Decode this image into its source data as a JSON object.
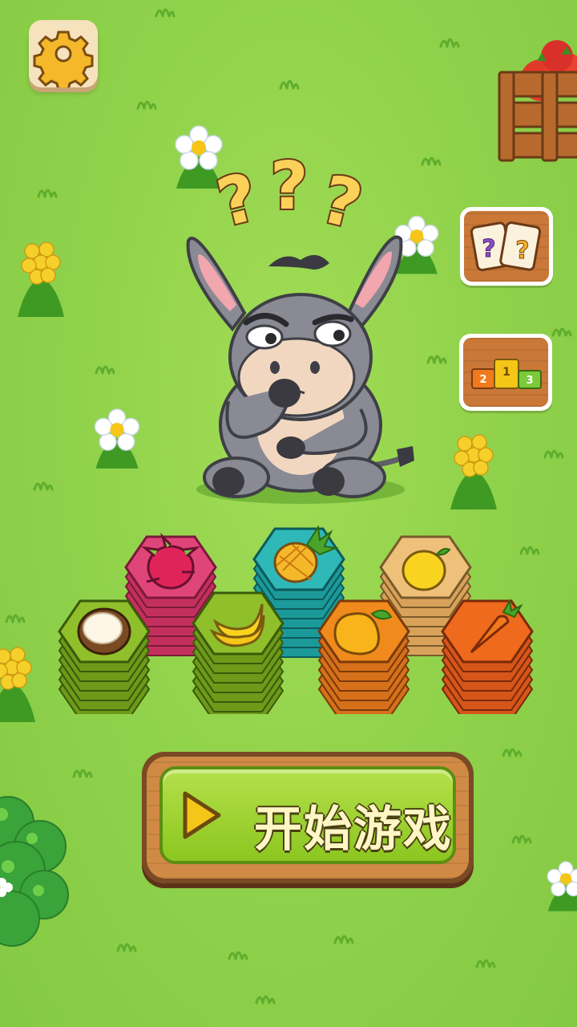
{
  "game": {
    "start_button_label": "开始游戏",
    "leaderboard_ranks": [
      "2",
      "1",
      "3"
    ],
    "help_card_symbols": [
      "?",
      "?"
    ],
    "mascot_thought": [
      "?",
      "?",
      "?"
    ],
    "tiles": [
      {
        "fruit": "dragon-fruit",
        "color": "#e0457a"
      },
      {
        "fruit": "pineapple",
        "color": "#2fb8b8"
      },
      {
        "fruit": "lemon",
        "color": "#eec07a"
      },
      {
        "fruit": "coconut",
        "color": "#8fbf2a"
      },
      {
        "fruit": "banana",
        "color": "#8fbf2a"
      },
      {
        "fruit": "mango",
        "color": "#f08a1c"
      },
      {
        "fruit": "carrot",
        "color": "#ef6a1c"
      }
    ]
  },
  "icons": {
    "settings": "gear-icon",
    "help": "question-cards-icon",
    "leaderboard": "podium-icon",
    "play": "play-triangle-icon"
  },
  "colors": {
    "grass": "#8fd14a",
    "wood": "#c97838",
    "start_green": "#9fd234",
    "start_text": "#fff6c6"
  }
}
